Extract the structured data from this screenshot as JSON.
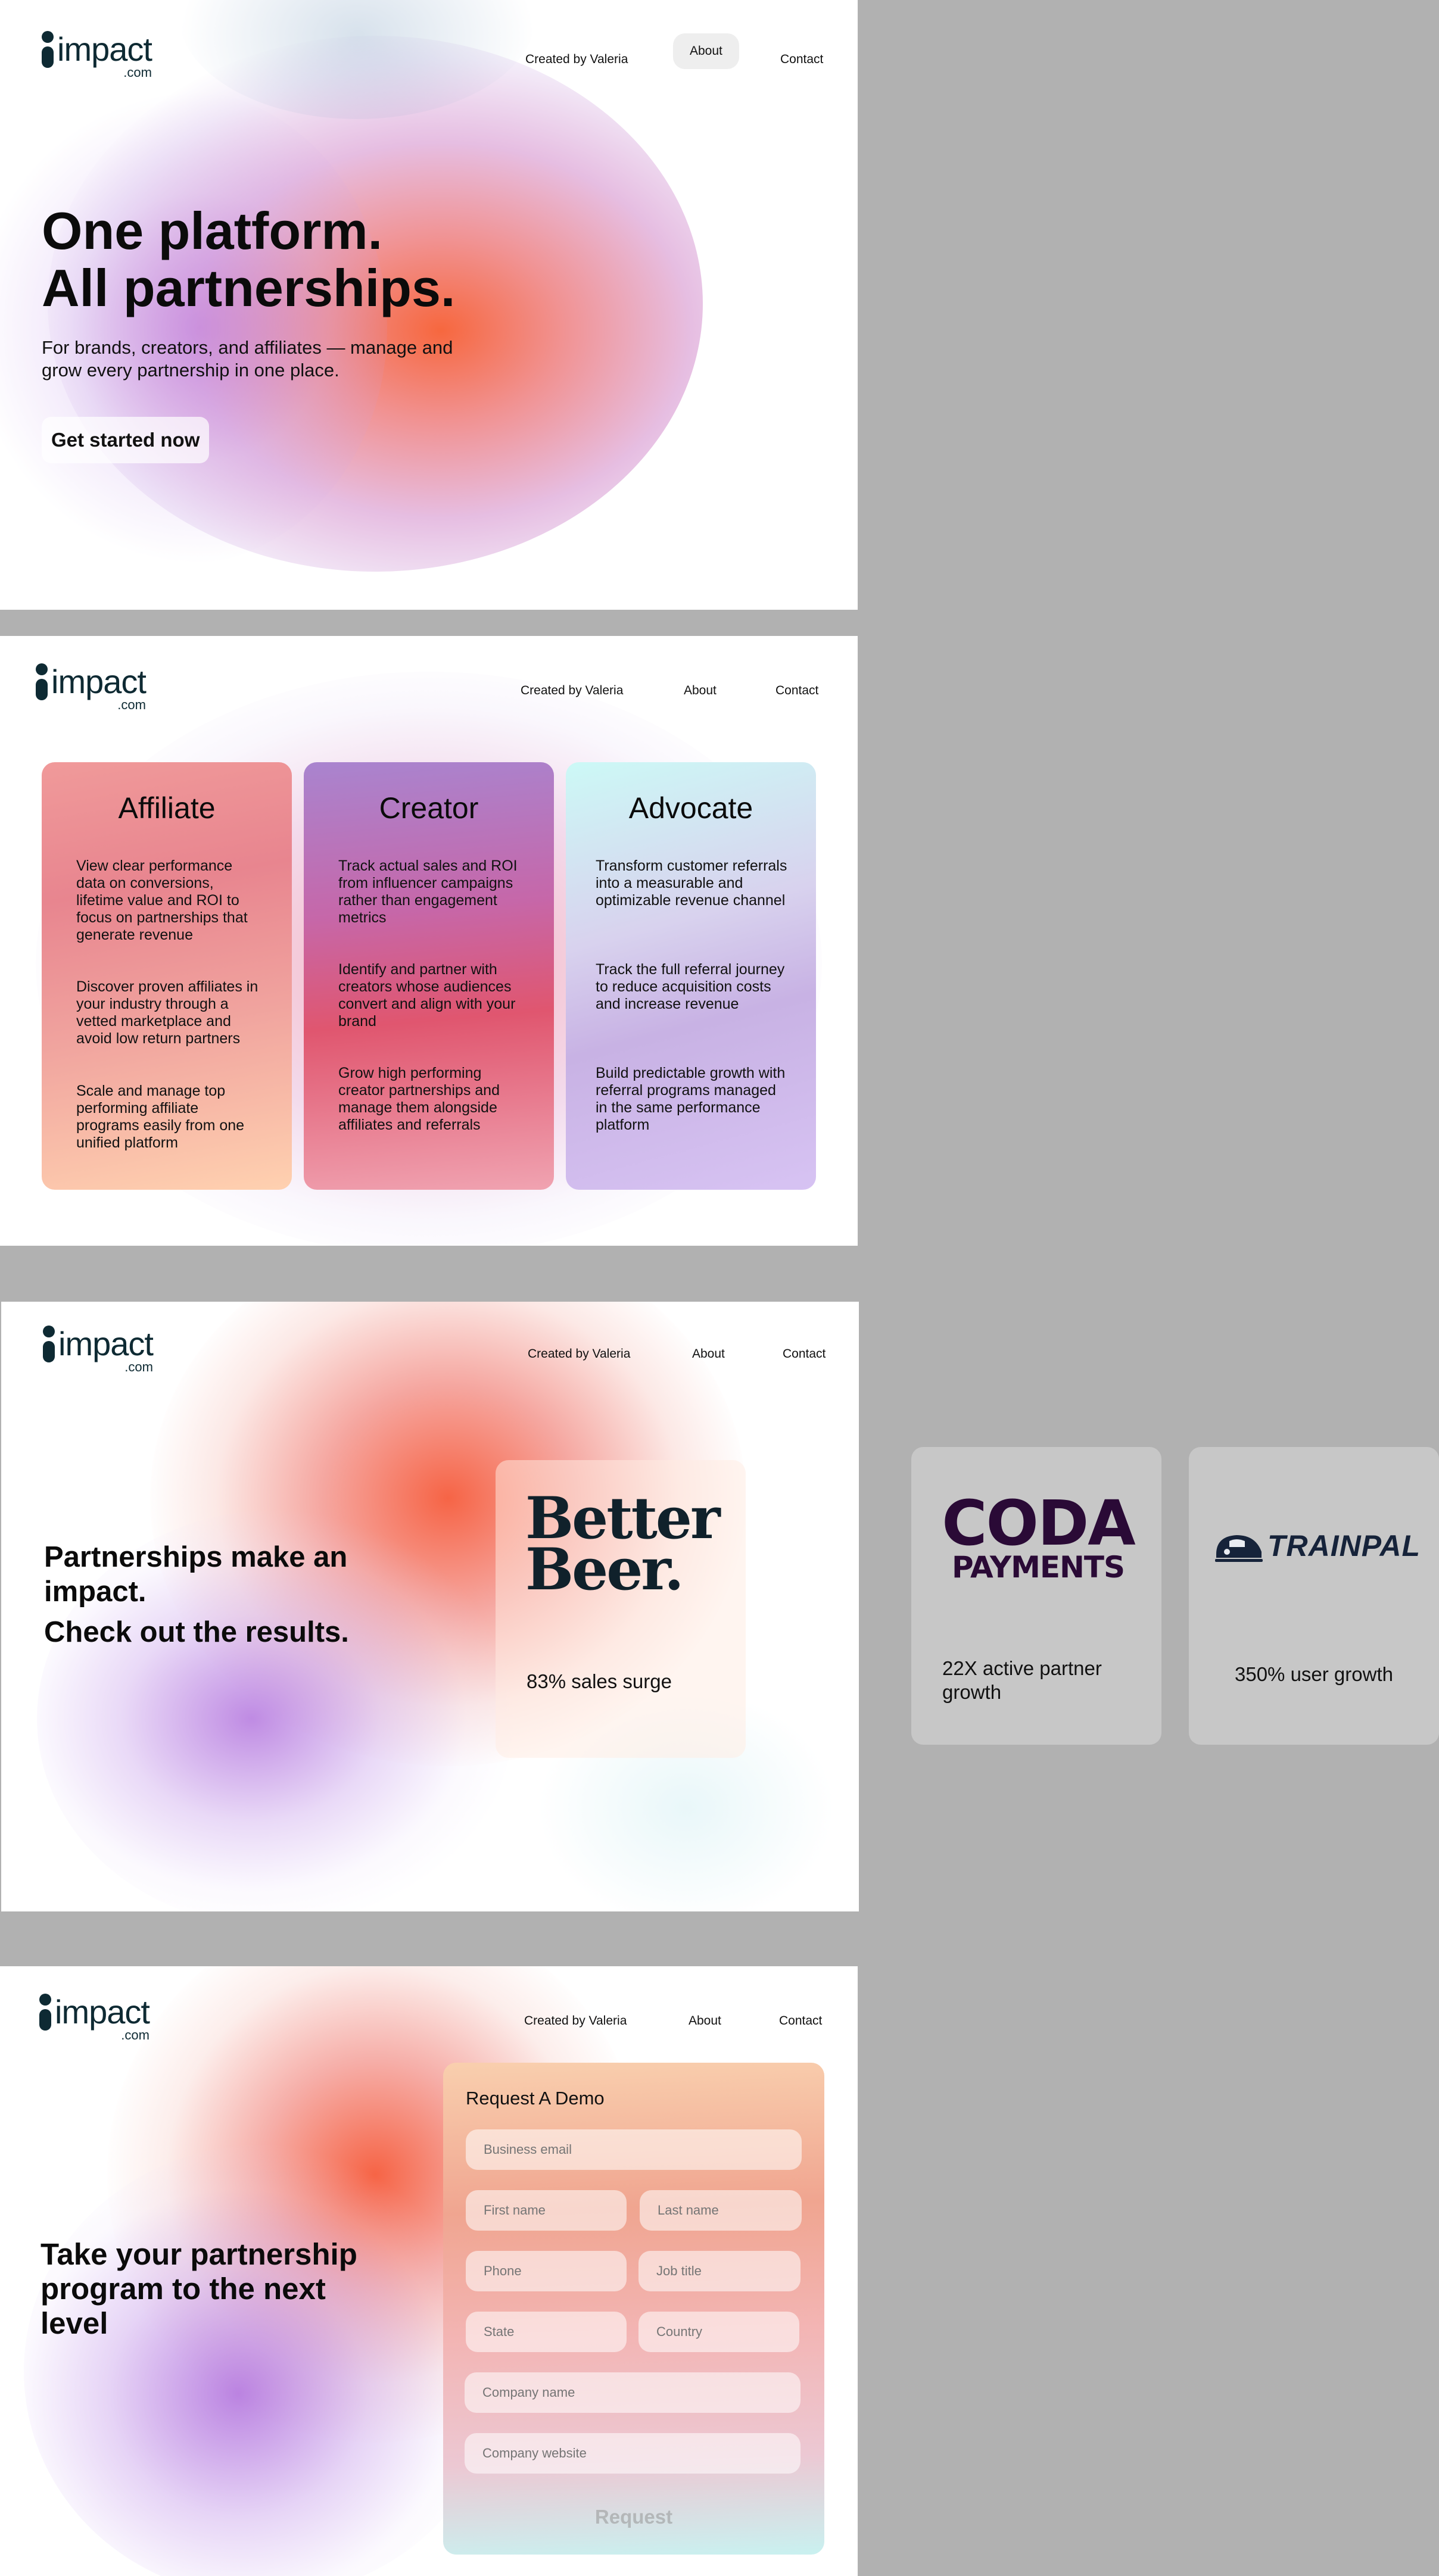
{
  "nav": {
    "logo_word": "impact",
    "logo_sub": ".com",
    "created_by": "Created by Valeria",
    "about": "About",
    "contact": "Contact"
  },
  "hero": {
    "title_line1": "One platform.",
    "title_line2": "All partnerships.",
    "subtitle": "For brands, creators, and affiliates — manage and grow every partnership in one place.",
    "cta": "Get started now"
  },
  "audiences": [
    {
      "title": "Affiliate",
      "points": [
        "View clear performance data on conversions, lifetime value and ROI to focus on partnerships that generate revenue",
        "Discover proven affiliates in your industry through a vetted marketplace and avoid low return partners",
        "Scale and manage top performing affiliate programs easily from one unified platform"
      ]
    },
    {
      "title": "Creator",
      "points": [
        "Track actual sales and ROI from influencer campaigns rather than engagement metrics",
        "Identify and partner with creators whose audiences convert and align with your brand",
        "Grow high performing creator partnerships and manage them alongside affiliates and referrals"
      ]
    },
    {
      "title": "Advocate",
      "points": [
        "Transform customer referrals into a measurable and optimizable revenue channel",
        "Track the full referral journey to reduce acquisition costs and increase revenue",
        "Build predictable growth with referral programs managed in the same performance platform"
      ]
    }
  ],
  "results": {
    "title_line1": "Partnerships make an impact.",
    "title_line2": "Check out the results.",
    "cases": [
      {
        "logo_line1": "Better",
        "logo_line2": "Beer.",
        "stat": "83% sales surge",
        "logo_color": "#10212b"
      },
      {
        "logo_line1": "CODA",
        "logo_line2": "PAYMENTS",
        "stat": "22X active partner growth",
        "logo_color": "#2a0a36"
      },
      {
        "logo_line1": "TRAINPAL",
        "stat": "350% user growth",
        "logo_color": "#16233a"
      }
    ]
  },
  "demo": {
    "heading": "Take your partnership program to the next level",
    "form_title": "Request A Demo",
    "placeholders": {
      "business_email": "Business email",
      "first_name": "First name",
      "last_name": "Last name",
      "phone": "Phone",
      "job_title": "Job title",
      "state": "State",
      "country": "Country",
      "company_name": "Company name",
      "company_website": "Company website"
    },
    "submit": "Request"
  },
  "colors": {
    "page_background": "#b1b1b1",
    "logo": "#0e2a33",
    "gradient_orange": "#f5673a",
    "gradient_purple": "#b07ad8",
    "gradient_pink": "#e0567a"
  }
}
